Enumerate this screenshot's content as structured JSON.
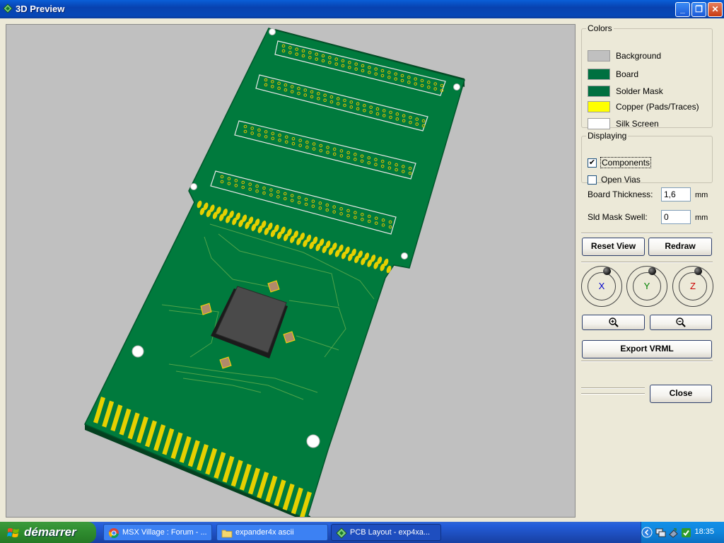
{
  "window": {
    "title": "3D Preview",
    "controls": {
      "minimize": "_",
      "restore": "❐",
      "close": "✕"
    }
  },
  "colors_group": {
    "legend": "Colors",
    "items": [
      {
        "label": "Background",
        "color": "#c0c0c0"
      },
      {
        "label": "Board",
        "color": "#007040"
      },
      {
        "label": "Solder Mask",
        "color": "#007040"
      },
      {
        "label": "Copper (Pads/Traces)",
        "color": "#ffff00"
      },
      {
        "label": "Silk Screen",
        "color": "#ffffff"
      }
    ]
  },
  "displaying_group": {
    "legend": "Displaying",
    "items": [
      {
        "label": "Components",
        "checked": true,
        "check_mark": "✔"
      },
      {
        "label": "Open Vias",
        "checked": false,
        "check_mark": ""
      }
    ]
  },
  "board_thickness": {
    "label": "Board Thickness:",
    "value": "1,6",
    "unit": "mm"
  },
  "sld_mask_swell": {
    "label": "Sld Mask Swell:",
    "value": "0",
    "unit": "mm"
  },
  "buttons": {
    "reset_view": "Reset View",
    "redraw": "Redraw",
    "zoom_in": "🔍",
    "zoom_out": "🔍",
    "export_vrml": "Export VRML",
    "close": "Close"
  },
  "rotation": {
    "x_label": "X",
    "x_color": "#0000cc",
    "y_label": "Y",
    "y_color": "#008000",
    "z_label": "Z",
    "z_color": "#cc0000"
  },
  "taskbar": {
    "start_label": "démarrer",
    "tasks": [
      {
        "label": "MSX Village : Forum - ...",
        "icon": "chrome-icon"
      },
      {
        "label": "expander4x ascii",
        "icon": "folder-icon"
      },
      {
        "label": "PCB Layout - exp4xa...",
        "icon": "pcb-icon"
      }
    ],
    "clock": "18:35"
  }
}
